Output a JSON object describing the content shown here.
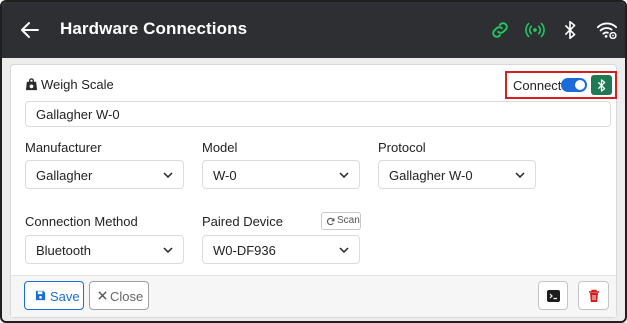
{
  "header": {
    "title": "Hardware Connections",
    "icons": [
      "arrow-left-icon",
      "link-icon",
      "broadcast-icon",
      "bluetooth-icon",
      "wifi-settings-icon"
    ]
  },
  "device": {
    "section_label": "Weigh Scale",
    "name": "Gallagher W-0",
    "connect_label": "Connect",
    "connected": true
  },
  "fields": {
    "manufacturer": {
      "label": "Manufacturer",
      "value": "Gallagher"
    },
    "model": {
      "label": "Model",
      "value": "W-0"
    },
    "protocol": {
      "label": "Protocol",
      "value": "Gallagher W-0"
    },
    "connection_method": {
      "label": "Connection Method",
      "value": "Bluetooth"
    },
    "paired_device": {
      "label": "Paired Device",
      "value": "W0-DF936",
      "scan_label": "Scan"
    }
  },
  "footer": {
    "save_label": "Save",
    "close_label": "Close"
  },
  "colors": {
    "appbar": "#2d2f33",
    "accent_blue": "#1a6dd8",
    "accent_green": "#22c55e",
    "bluetooth_green": "#1d7a52",
    "delete_red": "#d42020",
    "highlight_red": "#d42020"
  }
}
